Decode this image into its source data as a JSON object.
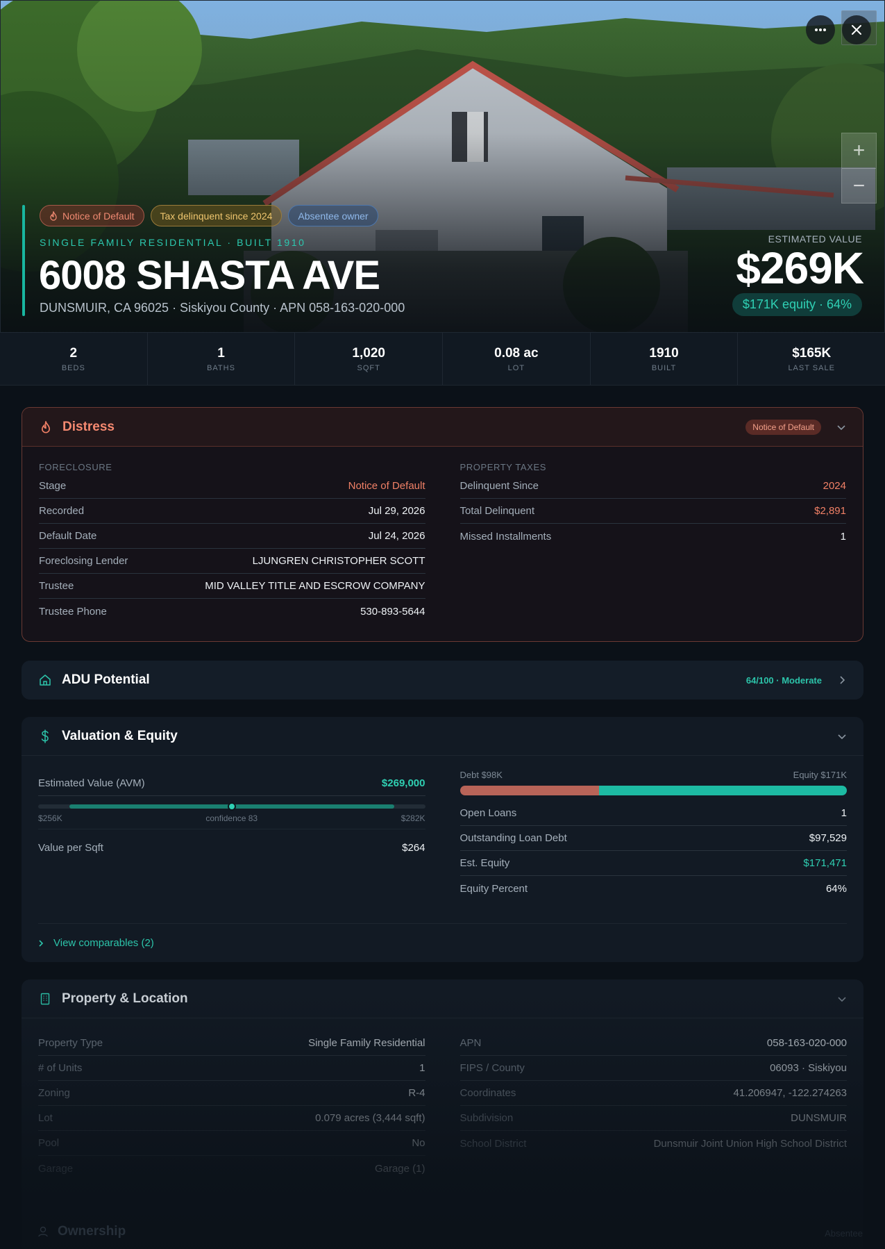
{
  "hero": {
    "more_icon": "more-horizontal-icon",
    "close_icon": "close-icon",
    "zoom_in_label": "+",
    "zoom_out_label": "−",
    "badges": [
      {
        "label": "Notice of Default",
        "icon": "flame-icon"
      },
      {
        "label": "Tax delinquent since 2024"
      },
      {
        "label": "Absentee owner"
      }
    ],
    "kicker": "SINGLE FAMILY RESIDENTIAL · BUILT 1910",
    "title": "6008 SHASTA AVE",
    "subtitle": "DUNSMUIR, CA 96025 · Siskiyou County · APN 058-163-020-000",
    "estimated_label": "ESTIMATED VALUE",
    "estimated_value": "$269K",
    "equity_pill": "$171K equity · 64%"
  },
  "stats": [
    {
      "value": "2",
      "label": "BEDS"
    },
    {
      "value": "1",
      "label": "BATHS"
    },
    {
      "value": "1,020",
      "label": "SQFT"
    },
    {
      "value": "0.08 ac",
      "label": "LOT"
    },
    {
      "value": "1910",
      "label": "BUILT"
    },
    {
      "value": "$165K",
      "label": "LAST SALE"
    }
  ],
  "distress": {
    "title": "Distress",
    "icon": "flame-icon",
    "chip": "Notice of Default",
    "foreclosure_label": "FORECLOSURE",
    "foreclosure": [
      {
        "k": "Stage",
        "v": "Notice of Default"
      },
      {
        "k": "Recorded",
        "v": "Jul 29, 2026"
      },
      {
        "k": "Default Date",
        "v": "Jul 24, 2026"
      },
      {
        "k": "Foreclosing Lender",
        "v": "LJUNGREN CHRISTOPHER SCOTT"
      },
      {
        "k": "Trustee",
        "v": "MID VALLEY TITLE AND ESCROW COMPANY"
      },
      {
        "k": "Trustee Phone",
        "v": "530-893-5644"
      }
    ],
    "taxes_label": "PROPERTY TAXES",
    "taxes": [
      {
        "k": "Delinquent Since",
        "v": "2024"
      },
      {
        "k": "Total Delinquent",
        "v": "$2,891"
      },
      {
        "k": "Missed Installments",
        "v": "1"
      }
    ]
  },
  "adu": {
    "title": "ADU Potential",
    "icon": "home-icon",
    "score": "64/100 · Moderate"
  },
  "valuation": {
    "title": "Valuation & Equity",
    "icon": "dollar-icon",
    "avm_label": "Estimated Value (AVM)",
    "avm_value": "$269,000",
    "avm_low": "$256K",
    "avm_high": "$282K",
    "avm_confidence": "confidence 83",
    "avm_range_start": 0.08,
    "avm_range_end": 0.92,
    "avm_marker": 0.5,
    "value_per_sqft_label": "Value per Sqft",
    "value_per_sqft": "$264",
    "debt_label": "Debt $98K",
    "equity_label": "Equity $171K",
    "debt_fraction": 0.36,
    "loans": [
      {
        "k": "Open Loans",
        "v": "1"
      },
      {
        "k": "Outstanding Loan Debt",
        "v": "$97,529"
      },
      {
        "k": "Est. Equity",
        "v": "$171,471"
      },
      {
        "k": "Equity Percent",
        "v": "64%"
      }
    ],
    "comparables": "View comparables (2)"
  },
  "property": {
    "title": "Property & Location",
    "icon": "building-icon",
    "left": [
      {
        "k": "Property Type",
        "v": "Single Family Residential"
      },
      {
        "k": "# of Units",
        "v": "1"
      },
      {
        "k": "Zoning",
        "v": "R-4"
      },
      {
        "k": "Lot",
        "v": "0.079 acres (3,444 sqft)"
      },
      {
        "k": "Pool",
        "v": "No"
      },
      {
        "k": "Garage",
        "v": "Garage (1)"
      }
    ],
    "right": [
      {
        "k": "APN",
        "v": "058-163-020-000"
      },
      {
        "k": "FIPS / County",
        "v": "06093 · Siskiyou"
      },
      {
        "k": "Coordinates",
        "v": "41.206947, -122.274263"
      },
      {
        "k": "Subdivision",
        "v": "DUNSMUIR"
      },
      {
        "k": "School District",
        "v": "Dunsmuir Joint Union High School District"
      }
    ]
  },
  "ownership": {
    "title": "Ownership",
    "right": "Absentee"
  },
  "colors": {
    "accent": "#19b6a0",
    "distress": "#f08066",
    "debt": "#b86458",
    "equity": "#1dbba3"
  }
}
